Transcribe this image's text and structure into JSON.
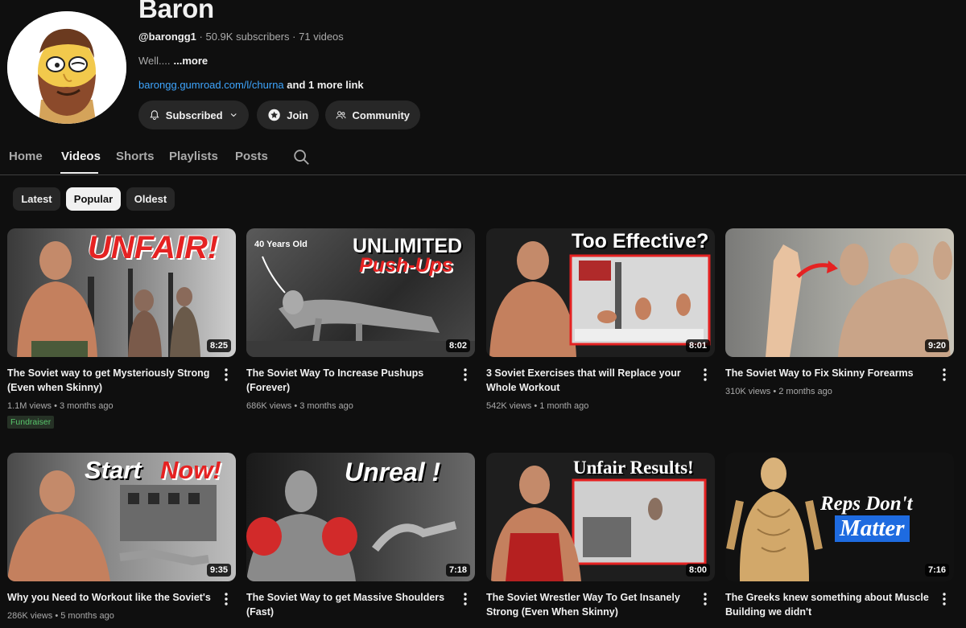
{
  "channel": {
    "name": "Baron",
    "handle": "@barongg1",
    "subscribers": "50.9K subscribers",
    "video_count": "71 videos",
    "description": "Well....",
    "more_label": "...more",
    "link_text": "barongg.gumroad.com/l/churna",
    "link_suffix": "and 1 more link"
  },
  "buttons": {
    "subscribed": "Subscribed",
    "join": "Join",
    "community": "Community"
  },
  "tabs": [
    "Home",
    "Videos",
    "Shorts",
    "Playlists",
    "Posts"
  ],
  "active_tab": "Videos",
  "chips": [
    "Latest",
    "Popular",
    "Oldest"
  ],
  "active_chip": "Popular",
  "videos": [
    {
      "title": "The Soviet way to get Mysteriously Strong (Even when Skinny)",
      "views": "1.1M views",
      "age": "3 months ago",
      "duration": "8:25",
      "badge": "Fundraiser",
      "overlay": "UNFAIR!"
    },
    {
      "title": "The Soviet Way To Increase Pushups (Forever)",
      "views": "686K views",
      "age": "3 months ago",
      "duration": "8:02",
      "overlay": "UNLIMITED",
      "overlay2": "Push-Ups",
      "overlay3": "40 Years Old"
    },
    {
      "title": "3 Soviet Exercises that will Replace your Whole Workout",
      "views": "542K views",
      "age": "1 month ago",
      "duration": "8:01",
      "overlay": "Too Effective?"
    },
    {
      "title": "The Soviet Way to Fix Skinny Forearms",
      "views": "310K views",
      "age": "2 months ago",
      "duration": "9:20"
    },
    {
      "title": "Why you Need to Workout like the Soviet's",
      "views": "286K views",
      "age": "5 months ago",
      "duration": "9:35",
      "overlay": "Start",
      "overlay2": "Now!"
    },
    {
      "title": "The Soviet Way to get Massive Shoulders (Fast)",
      "duration": "7:18",
      "overlay": "Unreal !"
    },
    {
      "title": "The Soviet Wrestler Way To Get Insanely Strong (Even When Skinny)",
      "duration": "8:00",
      "overlay": "Unfair Results!"
    },
    {
      "title": "The Greeks knew something about Muscle Building we didn't",
      "duration": "7:16",
      "overlay": "Reps Don't",
      "overlay2": "Matter"
    }
  ],
  "colors": {
    "background": "#0f0f0f",
    "chip_bg": "#272727",
    "link": "#3ea6ff",
    "fundraiser": "#57c46a",
    "overlay_red": "#e52222"
  }
}
